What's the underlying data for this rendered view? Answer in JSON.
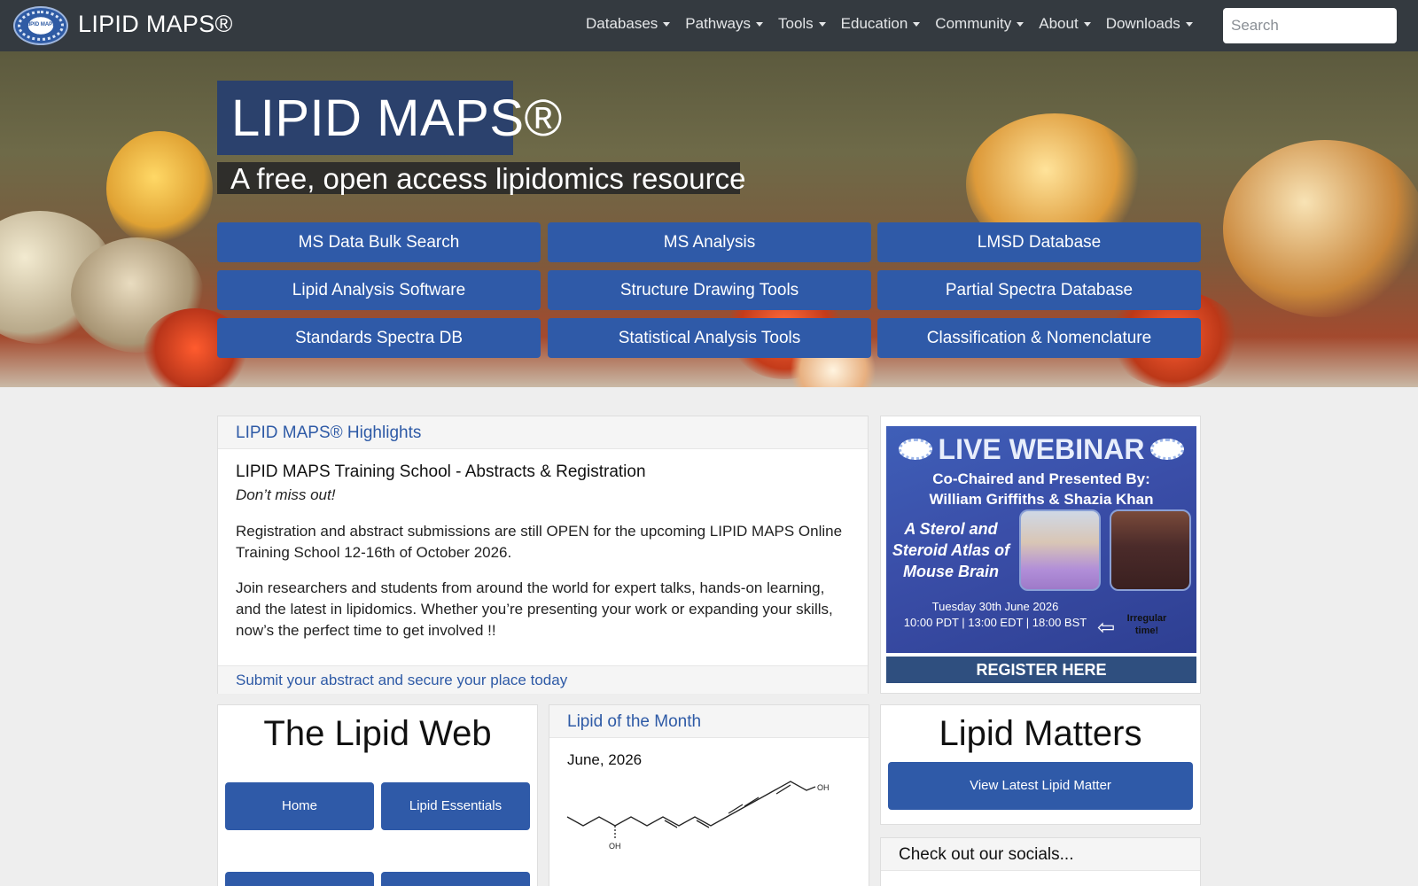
{
  "navbar": {
    "logo_text": "LIPID MAPS",
    "brand": "LIPID MAPS®",
    "menu": [
      {
        "label": "Databases"
      },
      {
        "label": "Pathways"
      },
      {
        "label": "Tools"
      },
      {
        "label": "Education"
      },
      {
        "label": "Community"
      },
      {
        "label": "About"
      },
      {
        "label": "Downloads"
      }
    ],
    "search_placeholder": "Search"
  },
  "hero": {
    "title": "LIPID MAPS®",
    "subtitle": "A free, open access lipidomics resource",
    "buttons": [
      "MS Data Bulk Search",
      "MS Analysis",
      "LMSD Database",
      "Lipid Analysis Software",
      "Structure Drawing Tools",
      "Partial Spectra Database",
      "Standards Spectra DB",
      "Statistical Analysis Tools",
      "Classification & Nomenclature"
    ]
  },
  "highlights": {
    "header": "LIPID MAPS® Highlights",
    "title": "LIPID MAPS Training School - Abstracts & Registration",
    "tagline": "Don’t miss out!",
    "para1": "Registration and abstract submissions are still OPEN for the upcoming LIPID MAPS Online Training School 12-16th of October 2026.",
    "para2": "Join researchers and students from around the world for expert talks, hands-on learning, and the latest in lipidomics. Whether you’re presenting your work or expanding your skills, now’s the perfect time to get involved !!",
    "footer_link": "Submit your abstract and secure your place today"
  },
  "webinar": {
    "logo_text": "LIPID MAPS",
    "title": "LIVE WEBINAR",
    "cochair_line1": "Co-Chaired and Presented By:",
    "cochair_line2": "William Griffiths & Shazia Khan",
    "atlas": "A Sterol and Steroid Atlas of Mouse Brain",
    "date": "Tuesday 30th June 2026",
    "times": "10:00 PDT | 13:00 EDT | 18:00 BST",
    "irregular": "Irregular time!",
    "register": "REGISTER HERE"
  },
  "lipid_web": {
    "title": "The Lipid Web",
    "buttons": [
      "Home",
      "Lipid Essentials"
    ]
  },
  "lipid_of_month": {
    "header": "Lipid of the Month",
    "date": "June, 2026",
    "oh_label": "OH"
  },
  "lipid_matters": {
    "title": "Lipid Matters",
    "button": "View Latest Lipid Matter"
  },
  "socials": {
    "header": "Check out our socials..."
  },
  "colors": {
    "navbar_bg": "#343a40",
    "primary_button": "#2f5aa8",
    "title_box": "#29406e",
    "link": "#2e5aa6"
  }
}
